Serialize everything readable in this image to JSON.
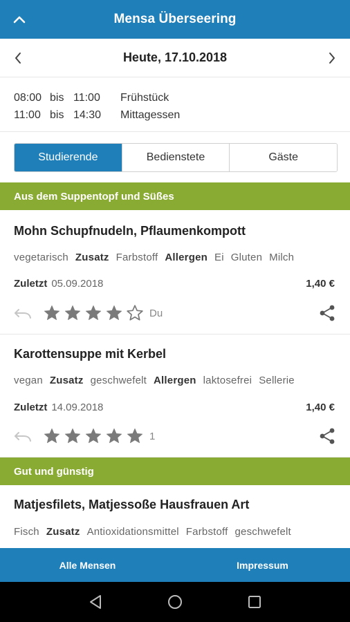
{
  "appbar": {
    "title": "Mensa Überseering",
    "up_icon": "chevron-up-icon"
  },
  "datebar": {
    "date": "Heute, 17.10.2018",
    "prev_icon": "chevron-left-icon",
    "next_icon": "chevron-right-icon"
  },
  "hours": [
    {
      "from": "08:00",
      "sep": "bis",
      "to": "11:00",
      "label": "Frühstück"
    },
    {
      "from": "11:00",
      "sep": "bis",
      "to": "14:30",
      "label": "Mittagessen"
    }
  ],
  "segments": [
    {
      "label": "Studierende",
      "selected": true
    },
    {
      "label": "Bedienstete",
      "selected": false
    },
    {
      "label": "Gäste",
      "selected": false
    }
  ],
  "sections": [
    {
      "title": "Aus dem Suppentopf und Süßes"
    },
    {
      "title": "Gut und günstig"
    }
  ],
  "meals": [
    {
      "name": "Mohn Schupfnudeln, Pflaumenkompott",
      "tags": [
        {
          "text": "vegetarisch",
          "bold": false
        },
        {
          "text": "Zusatz",
          "bold": true
        },
        {
          "text": "Farbstoff",
          "bold": false
        },
        {
          "text": "Allergen",
          "bold": true
        },
        {
          "text": "Ei",
          "bold": false
        },
        {
          "text": "Gluten",
          "bold": false
        },
        {
          "text": "Milch",
          "bold": false
        }
      ],
      "last_label": "Zuletzt",
      "last_date": "05.09.2018",
      "price": "1,40 €",
      "rating": 4,
      "rating_label": "Du"
    },
    {
      "name": "Karottensuppe mit Kerbel",
      "tags": [
        {
          "text": "vegan",
          "bold": false
        },
        {
          "text": "Zusatz",
          "bold": true
        },
        {
          "text": "geschwefelt",
          "bold": false
        },
        {
          "text": "Allergen",
          "bold": true
        },
        {
          "text": "laktosefrei",
          "bold": false
        },
        {
          "text": "Sellerie",
          "bold": false
        }
      ],
      "last_label": "Zuletzt",
      "last_date": "14.09.2018",
      "price": "1,40 €",
      "rating": 5,
      "rating_label": "1"
    },
    {
      "name": "Matjesfilets, Matjessoße Hausfrauen Art",
      "tags": [
        {
          "text": "Fisch",
          "bold": false
        },
        {
          "text": "Zusatz",
          "bold": true
        },
        {
          "text": "Antioxidationsmittel",
          "bold": false
        },
        {
          "text": "Farbstoff",
          "bold": false
        },
        {
          "text": "geschwefelt",
          "bold": false
        }
      ]
    }
  ],
  "bottom_tabs": [
    {
      "label": "Alle Mensen"
    },
    {
      "label": "Impressum"
    }
  ],
  "system_nav": [
    "back-icon",
    "home-icon",
    "recents-icon"
  ],
  "colors": {
    "primary": "#1f7fb9",
    "section": "#8aab33",
    "star": "#7a7a7a"
  }
}
